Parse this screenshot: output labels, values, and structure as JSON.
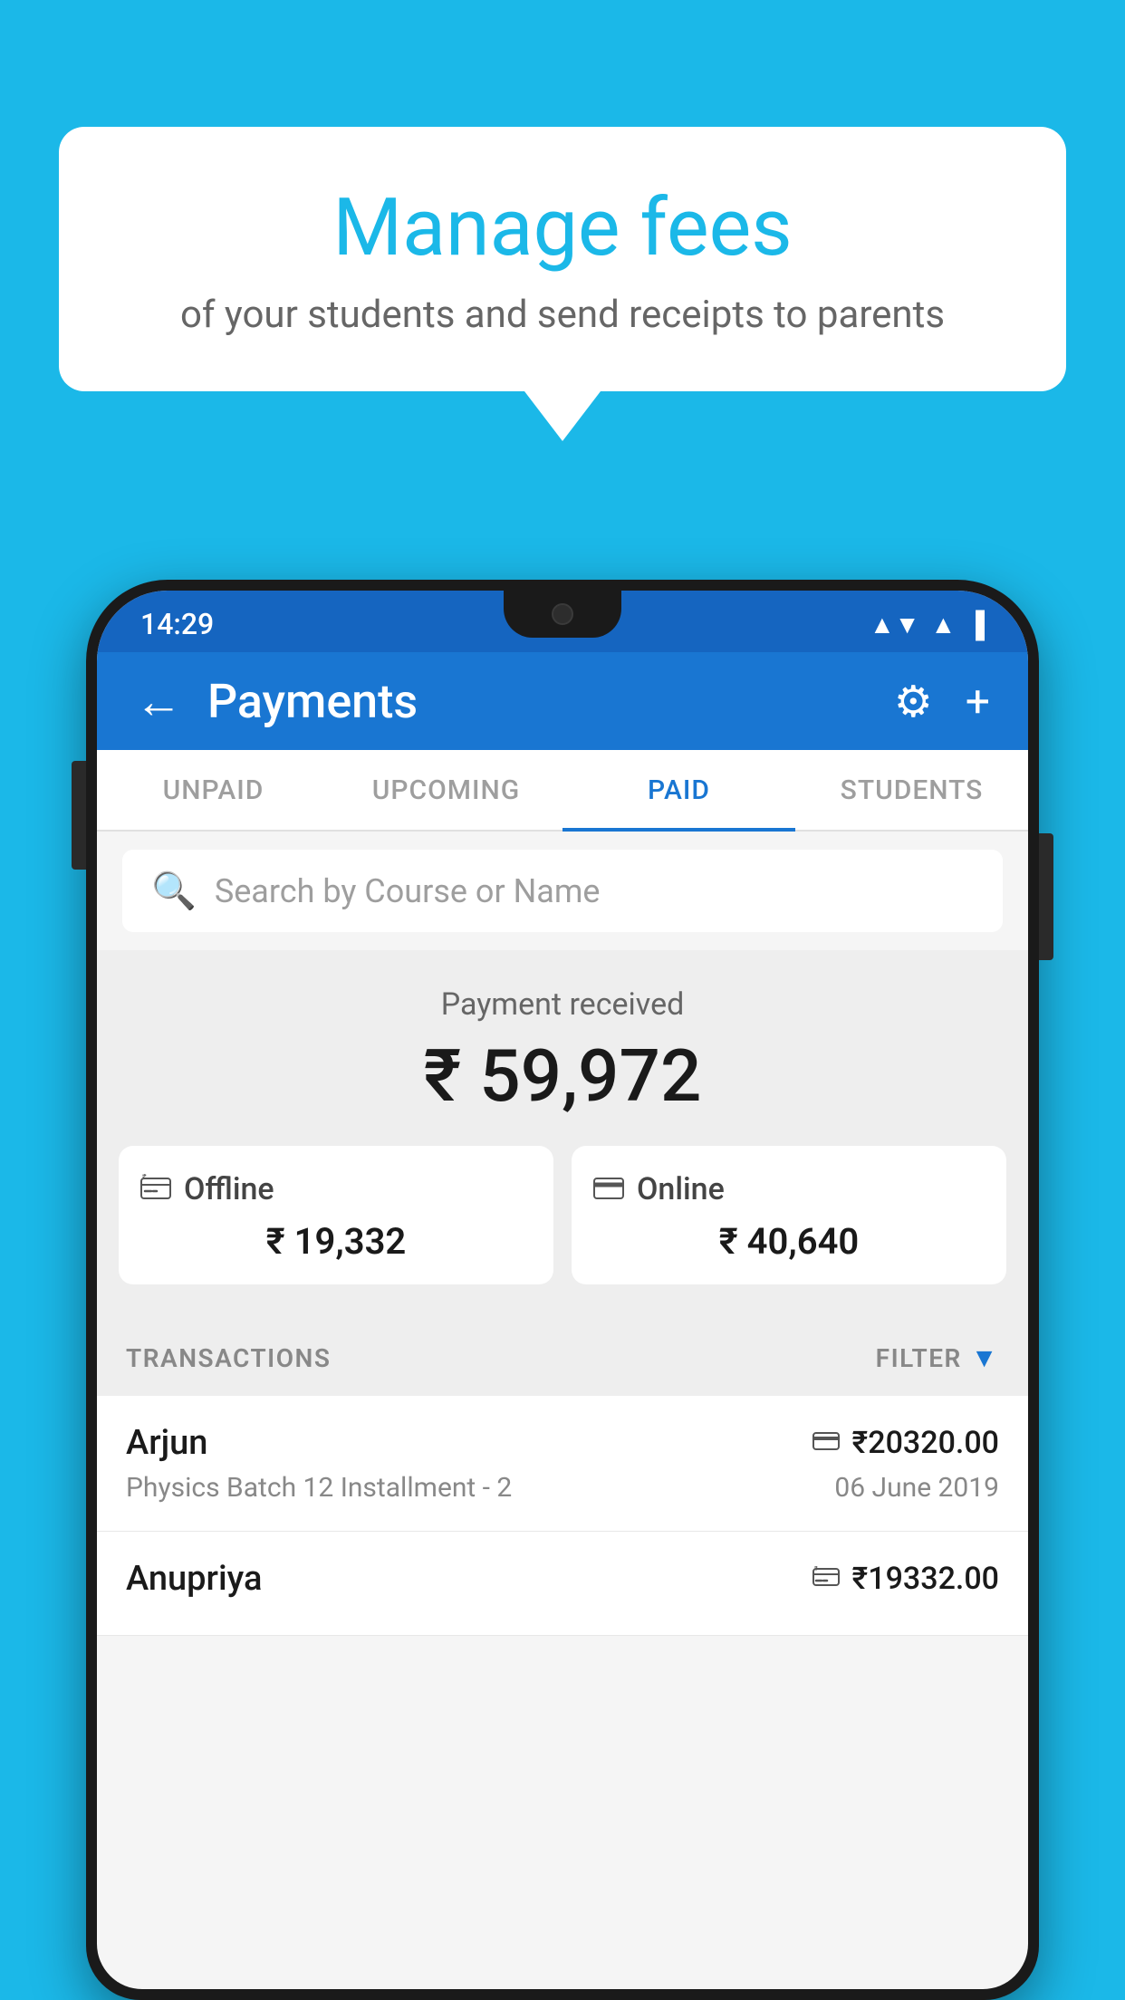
{
  "background_color": "#1BB8E8",
  "speech_bubble": {
    "title": "Manage fees",
    "subtitle": "of your students and send receipts to parents"
  },
  "phone": {
    "status_bar": {
      "time": "14:29",
      "wifi_icon": "▼",
      "signal_icon": "▲",
      "battery_icon": "▐"
    },
    "header": {
      "title": "Payments",
      "back_label": "←",
      "gear_label": "⚙",
      "plus_label": "+"
    },
    "tabs": [
      {
        "label": "UNPAID",
        "active": false
      },
      {
        "label": "UPCOMING",
        "active": false
      },
      {
        "label": "PAID",
        "active": true
      },
      {
        "label": "STUDENTS",
        "active": false
      }
    ],
    "search": {
      "placeholder": "Search by Course or Name"
    },
    "payment_received": {
      "label": "Payment received",
      "total": "₹ 59,972",
      "offline": {
        "icon": "💳",
        "label": "Offline",
        "amount": "₹ 19,332"
      },
      "online": {
        "icon": "💳",
        "label": "Online",
        "amount": "₹ 40,640"
      }
    },
    "transactions": {
      "header_label": "TRANSACTIONS",
      "filter_label": "FILTER",
      "rows": [
        {
          "name": "Arjun",
          "course": "Physics Batch 12 Installment - 2",
          "amount": "₹20320.00",
          "date": "06 June 2019",
          "payment_type": "online"
        },
        {
          "name": "Anupriya",
          "course": "",
          "amount": "₹19332.00",
          "date": "",
          "payment_type": "offline"
        }
      ]
    }
  }
}
